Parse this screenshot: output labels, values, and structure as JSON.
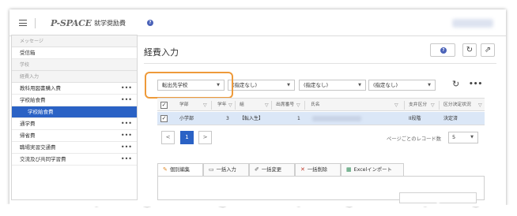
{
  "header": {
    "logo_text": "P-SPACE",
    "app_title": "就学奨励費",
    "help_symbol": "?"
  },
  "sidebar": {
    "groups": [
      {
        "label": "メッセージ"
      },
      {
        "label": "学校"
      },
      {
        "label": "経費入力"
      }
    ],
    "items": [
      {
        "label": "受信箱"
      },
      {
        "label": "教科用図書購入費",
        "more": "•••"
      },
      {
        "label": "学校給食費",
        "more": "•••"
      },
      {
        "label": "学校給食費"
      },
      {
        "label": "通学費",
        "more": "•••"
      },
      {
        "label": "帰省費",
        "more": "•••"
      },
      {
        "label": "職場実習交通費",
        "more": "•••"
      },
      {
        "label": "交流及び共同学習費",
        "more": "•••"
      }
    ]
  },
  "main": {
    "title": "経費入力",
    "help_symbol": "?",
    "refresh_icon": "↻",
    "export_icon": "⇗",
    "filters": [
      {
        "value": "転出先学校"
      },
      {
        "value": "(指定なし)"
      },
      {
        "value": "(指定なし)"
      },
      {
        "value": "(指定なし)"
      }
    ],
    "toolbar_refresh": "↻",
    "toolbar_more": "•••",
    "table": {
      "headers": [
        "学部",
        "学年",
        "組",
        "出席番号",
        "氏名",
        "支弁区分",
        "区分決定状況"
      ],
      "rows": [
        {
          "checked": "✓",
          "学部": "小学部",
          "学年": "3",
          "組": "【転入生】",
          "出席番号": "1",
          "支弁区分": "II段階",
          "区分決定状況": "決定済"
        }
      ],
      "header_check": "✓"
    },
    "pager": {
      "prev": "<",
      "current": "1",
      "next": ">",
      "label": "ページごとのレコード数",
      "page_size": "5"
    },
    "actions": [
      {
        "label": "個別編集",
        "icon": "edit-icon"
      },
      {
        "label": "一括入力",
        "icon": "document-icon"
      },
      {
        "label": "一括変更",
        "icon": "pencil-icon"
      },
      {
        "label": "一括削除",
        "icon": "delete-icon"
      },
      {
        "label": "Excelインポート",
        "icon": "excel-icon"
      }
    ]
  },
  "colors": {
    "accent": "#2a62c5",
    "highlight": "#ee9a3a",
    "selected_row": "#dbe7f7"
  }
}
